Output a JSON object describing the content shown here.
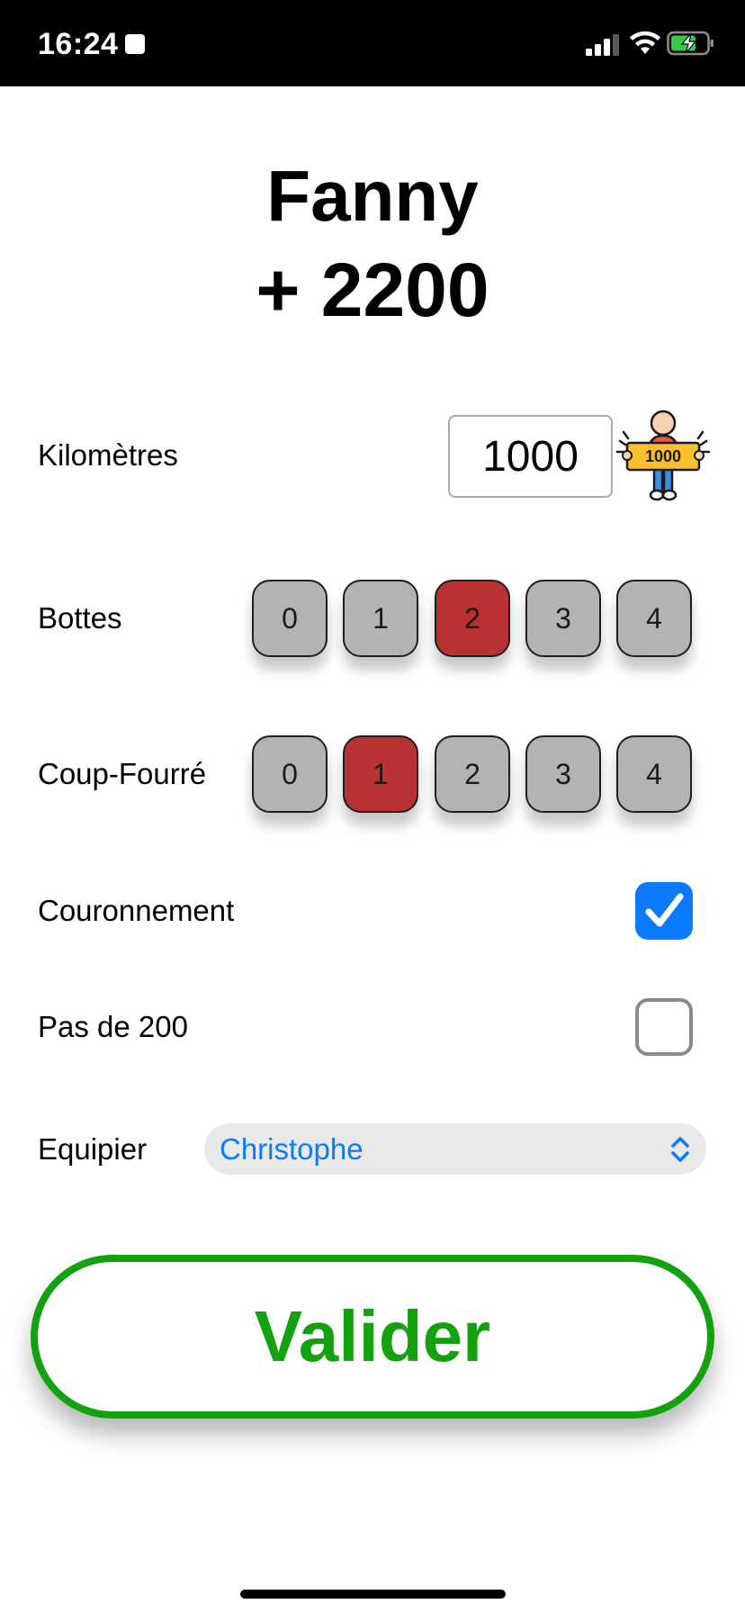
{
  "status_bar": {
    "time": "16:24",
    "icons": [
      "stop-square-icon",
      "cellular-signal-icon",
      "wifi-icon",
      "battery-charging-icon"
    ]
  },
  "header": {
    "player_name": "Fanny",
    "score": "+ 2200"
  },
  "kilometres": {
    "label": "Kilomètres",
    "value": "1000",
    "sign_text": "1000",
    "icon": "person-holding-1000-sign-icon"
  },
  "bottes": {
    "label": "Bottes",
    "options": [
      "0",
      "1",
      "2",
      "3",
      "4"
    ],
    "selected": "2"
  },
  "coup_fourre": {
    "label": "Coup-Fourré",
    "options": [
      "0",
      "1",
      "2",
      "3",
      "4"
    ],
    "selected": "1"
  },
  "couronnement": {
    "label": "Couronnement",
    "checked": true
  },
  "pas_de_200": {
    "label": "Pas de 200",
    "checked": false
  },
  "equipier": {
    "label": "Equipier",
    "selected": "Christophe"
  },
  "validate": {
    "label": "Valider"
  },
  "colors": {
    "accent_blue": "#0a7aff",
    "selected_red": "#b83232",
    "button_gray": "#b3b3b3",
    "validate_green": "#13a10e"
  }
}
